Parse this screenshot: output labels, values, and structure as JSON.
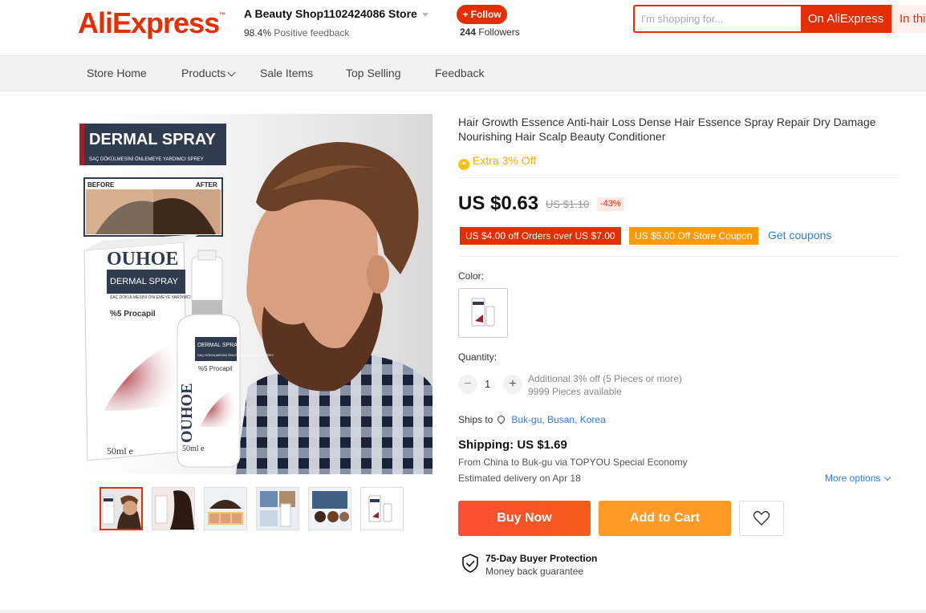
{
  "header": {
    "logo": "AliExpress",
    "logo_tm": "™",
    "store_name": "A Beauty Shop1102424086 Store",
    "positive_pct": "98.4%",
    "positive_label": "Positive feedback",
    "follow_label": "+ Follow",
    "followers_count": "244",
    "followers_label": "Followers",
    "search_placeholder": "I'm shopping for...",
    "search_on_ali": "On AliExpress",
    "search_in_store": "In thi"
  },
  "nav": {
    "items": [
      "Store Home",
      "Products",
      "Sale Items",
      "Top Selling",
      "Feedback"
    ]
  },
  "gallery": {
    "image_text": {
      "banner": "DERMAL SPRAY",
      "banner_sub": "SAÇ DÖKÜLMESİNİ ÖNLEMEYE YARDIMCI SPREY",
      "before": "BEFORE",
      "after": "AFTER",
      "brand": "OUHOE",
      "box_label": "DERMAL SPRAY",
      "box_sub": "SAÇ DÖKÜLMESİNİ ÖNLEMEYE YARDIMCI SPREY",
      "ingredient": "%5 Procapil",
      "volume": "50ml e",
      "bottle_label": "DERMAL SPRAY",
      "bottle_sub": "SAÇ DÖKÜLMESİNİ ÖNLEMEYE YARDIMCI SPREY",
      "bottle_ingredient": "%5 Procapil",
      "bottle_volume": "50ml e",
      "bottle_brand": "OUHOE"
    },
    "thumb_count": 6,
    "active_thumb": 0
  },
  "product": {
    "title": "Hair Growth Essence Anti-hair Loss Dense Hair Essence Spray Repair Dry Damage Nourishing Hair Scalp Beauty Conditioner",
    "extra_off": "Extra 3% Off",
    "price": "US $0.63",
    "old_price": "US $1.10",
    "discount": "-43%",
    "coupon_1": "US $4.00 off Orders over US $7.00",
    "coupon_2": "US $5.00 Off Store Coupon",
    "get_coupons": "Get coupons",
    "color_label": "Color:",
    "quantity_label": "Quantity:",
    "quantity_value": "1",
    "qty_info_1": "Additional 3% off (5 Pieces or more)",
    "qty_info_2": "9999 Pieces available",
    "ships_to_label": "Ships to",
    "ships_to_location": "Buk-gu, Busan, Korea",
    "shipping_price": "Shipping: US $1.69",
    "shipping_route": "From China to Buk-gu via TOPYOU Special Economy",
    "est_delivery": "Estimated delivery on Apr 18",
    "more_options": "More options",
    "buy_now": "Buy Now",
    "add_to_cart": "Add to Cart",
    "protection_title": "75-Day Buyer Protection",
    "protection_sub": "Money back guarantee"
  },
  "colors": {
    "brand_red": "#e62e04",
    "buy_now": "#f55b17",
    "add_to_cart": "#ff9b24",
    "coupon_yellow": "#ff9a00",
    "link_blue": "#2e7dd7"
  }
}
